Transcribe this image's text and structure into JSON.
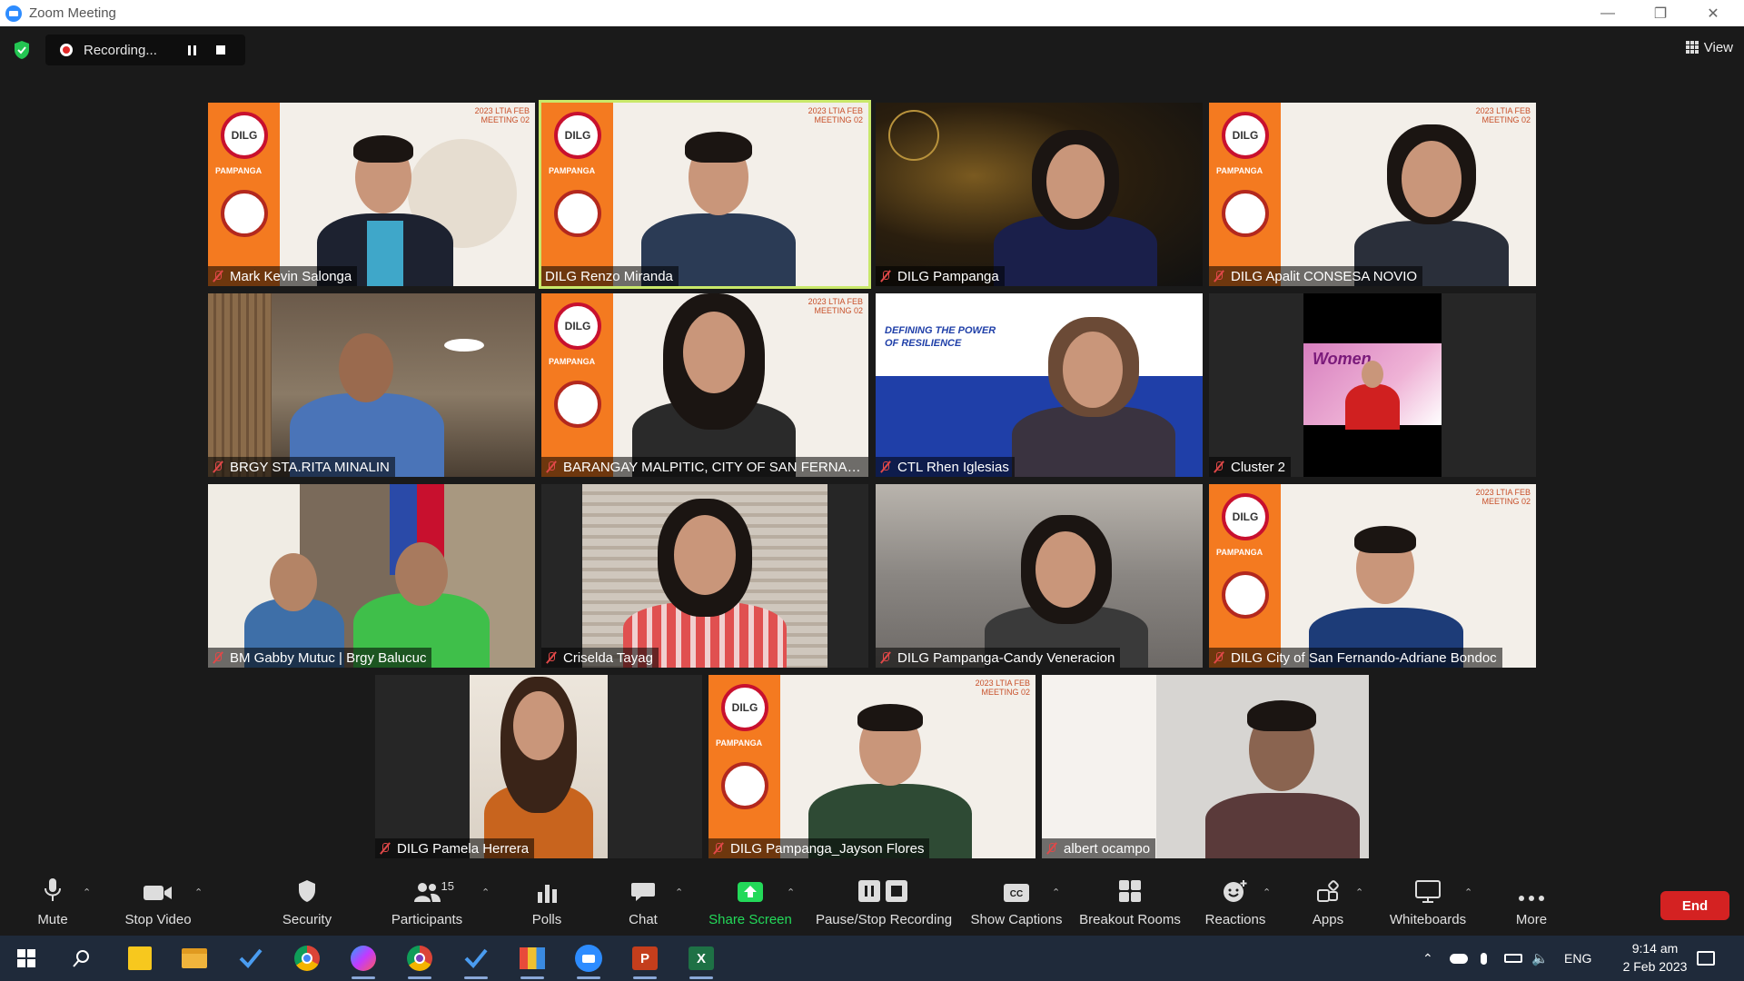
{
  "window": {
    "title": "Zoom Meeting"
  },
  "recording": {
    "label": "Recording..."
  },
  "view": {
    "label": "View"
  },
  "participants": [
    {
      "name": "Mark Kevin Salonga",
      "muted": true
    },
    {
      "name": "DILG Renzo Miranda",
      "muted": false,
      "active_speaker": true
    },
    {
      "name": "DILG Pampanga",
      "muted": true
    },
    {
      "name": "DILG Apalit CONSESA NOVIO",
      "muted": true
    },
    {
      "name": "BRGY STA.RITA MINALIN",
      "muted": true
    },
    {
      "name": "BARANGAY MALPITIC, CITY OF SAN FERNAN...",
      "muted": true
    },
    {
      "name": "CTL Rhen Iglesias",
      "muted": true
    },
    {
      "name": "Cluster 2",
      "muted": true
    },
    {
      "name": "BM Gabby Mutuc | Brgy Balucuc",
      "muted": true
    },
    {
      "name": "Criselda Tayag",
      "muted": true
    },
    {
      "name": "DILG Pampanga-Candy Veneracion",
      "muted": true
    },
    {
      "name": "DILG City of San Fernando-Adriane Bondoc",
      "muted": true
    },
    {
      "name": "DILG Pamela Herrera",
      "muted": true
    },
    {
      "name": "DILG Pampanga_Jayson Flores",
      "muted": true
    },
    {
      "name": "albert ocampo",
      "muted": true
    }
  ],
  "backgrounds": {
    "meeting_tag_1": "2023 LTIA",
    "meeting_tag_2": "MEETING",
    "meeting_tag_month": "FEB",
    "meeting_tag_day": "02",
    "dilg_logo": "DILG",
    "pampanga": "PAMPANGA",
    "resilience_title": "DEFINING THE POWER OF RESILIENCE",
    "women_banner": "Women"
  },
  "toolbar": {
    "mute": "Mute",
    "stop_video": "Stop Video",
    "security": "Security",
    "participants": "Participants",
    "participants_count": "15",
    "polls": "Polls",
    "chat": "Chat",
    "share_screen": "Share Screen",
    "pause_stop_recording": "Pause/Stop Recording",
    "show_captions": "Show Captions",
    "breakout_rooms": "Breakout Rooms",
    "reactions": "Reactions",
    "apps": "Apps",
    "whiteboards": "Whiteboards",
    "more": "More",
    "end": "End"
  },
  "taskbar": {
    "language": "ENG",
    "time": "9:14 am",
    "date": "2 Feb 2023"
  },
  "colors": {
    "accent_green": "#23d959",
    "end_red": "#d42222",
    "active_outline": "#c9e86a",
    "dilg_orange": "#f47a20"
  }
}
